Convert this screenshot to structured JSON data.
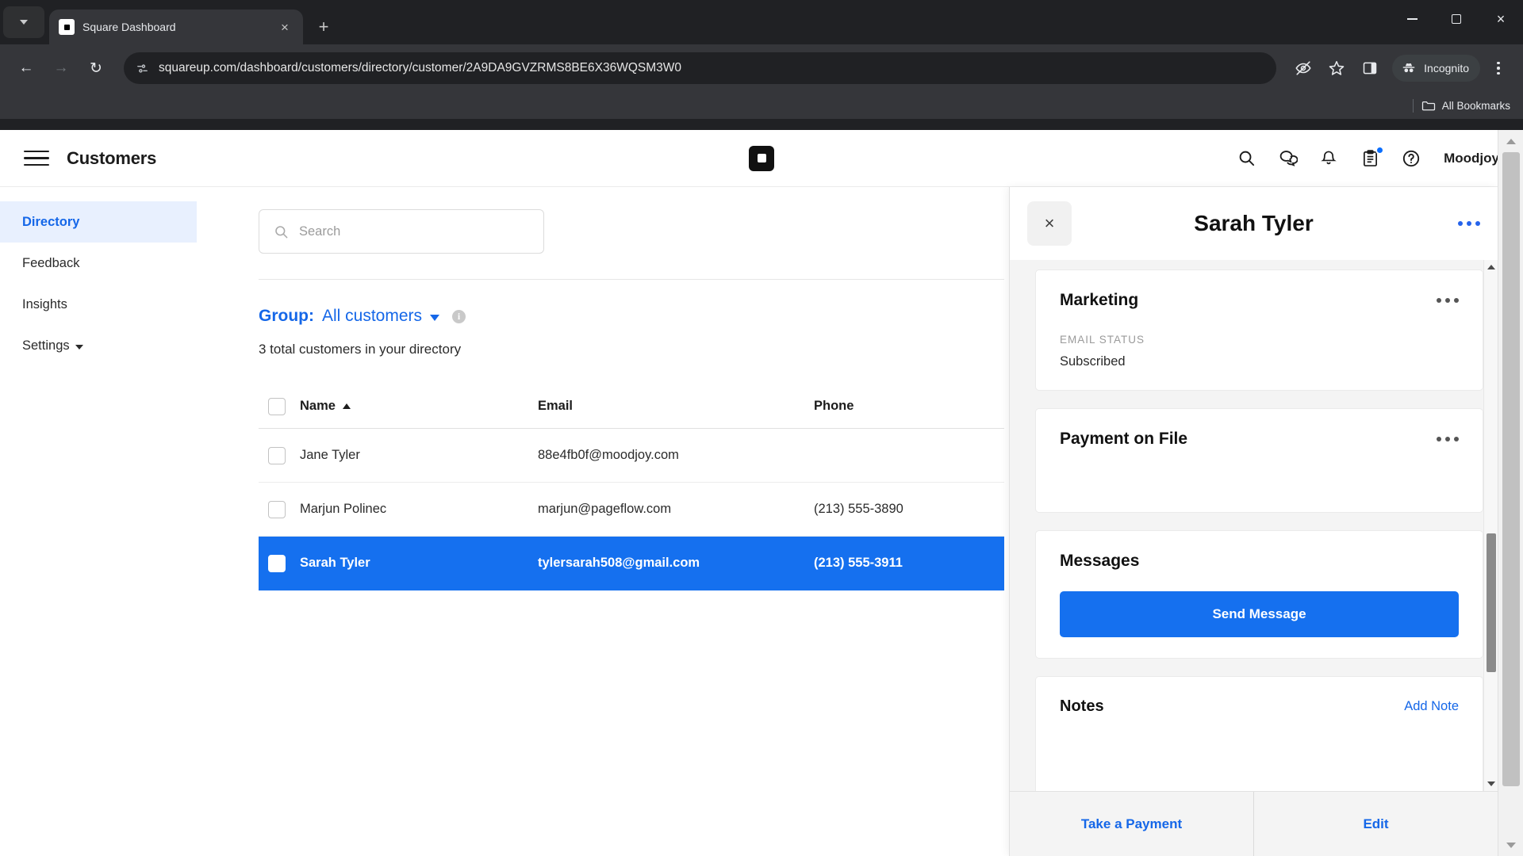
{
  "browser": {
    "tab": {
      "title": "Square Dashboard",
      "favicon": "square-logo-icon",
      "close": "×"
    },
    "new_tab_label": "+",
    "window_controls": {
      "minimize": "minimize-icon",
      "maximize": "maximize-icon",
      "close": "×"
    },
    "nav": {
      "back": "←",
      "forward": "→",
      "reload": "↻"
    },
    "omnibox": {
      "url": "squareup.com/dashboard/customers/directory/customer/2A9DA9GVZRMS8BE6X36WQSM3W0",
      "site_icon": "page-info-icon"
    },
    "toolbar_icons": [
      "eye-slash-icon",
      "bookmark-star-icon",
      "side-panel-icon"
    ],
    "incognito_label": "Incognito",
    "menu": "kebab-menu-icon",
    "bookmarks_bar": {
      "label": "All Bookmarks",
      "icon": "folder-icon"
    }
  },
  "app": {
    "header": {
      "menu_icon": "hamburger-icon",
      "title": "Customers",
      "logo": "square-logo-icon",
      "icons": [
        "search-icon",
        "chat-icon",
        "bell-icon",
        "clipboard-icon",
        "help-icon"
      ],
      "clipboard_has_badge": true,
      "account": "Moodjoy"
    },
    "sidebar": {
      "items": [
        {
          "label": "Directory",
          "active": true,
          "caret": false
        },
        {
          "label": "Feedback",
          "active": false,
          "caret": false
        },
        {
          "label": "Insights",
          "active": false,
          "caret": false
        },
        {
          "label": "Settings",
          "active": false,
          "caret": true
        }
      ]
    },
    "main": {
      "search": {
        "placeholder": "Search",
        "icon": "search-icon"
      },
      "group": {
        "label": "Group:",
        "value": "All customers",
        "caret": "chevron-down-icon",
        "info": "info-icon"
      },
      "total_text": "3 total customers in your directory",
      "table": {
        "columns": [
          "Name",
          "Email",
          "Phone"
        ],
        "sort_column": "Name",
        "sort_direction": "ascending",
        "rows": [
          {
            "name": "Jane Tyler",
            "email": "88e4fb0f@moodjoy.com",
            "phone": "",
            "selected": false
          },
          {
            "name": "Marjun Polinec",
            "email": "marjun@pageflow.com",
            "phone": "(213) 555-3890",
            "selected": false
          },
          {
            "name": "Sarah Tyler",
            "email": "tylersarah508@gmail.com",
            "phone": "(213) 555-3911",
            "selected": true
          }
        ]
      }
    },
    "panel": {
      "close_icon": "×",
      "title": "Sarah Tyler",
      "overflow": "more-options-icon",
      "cards": {
        "marketing": {
          "title": "Marketing",
          "overflow": "more-options-icon",
          "field_label": "EMAIL STATUS",
          "field_value": "Subscribed"
        },
        "payment": {
          "title": "Payment on File",
          "overflow": "more-options-icon"
        },
        "messages": {
          "title": "Messages",
          "button": "Send Message"
        },
        "notes": {
          "title": "Notes",
          "action": "Add Note"
        }
      },
      "footer": {
        "take_payment": "Take a Payment",
        "edit": "Edit"
      }
    }
  },
  "colors": {
    "accent_blue": "#1570ef",
    "link_blue": "#1567e8",
    "sidebar_active_bg": "#e8f0fe",
    "chrome_dark": "#35363a"
  }
}
